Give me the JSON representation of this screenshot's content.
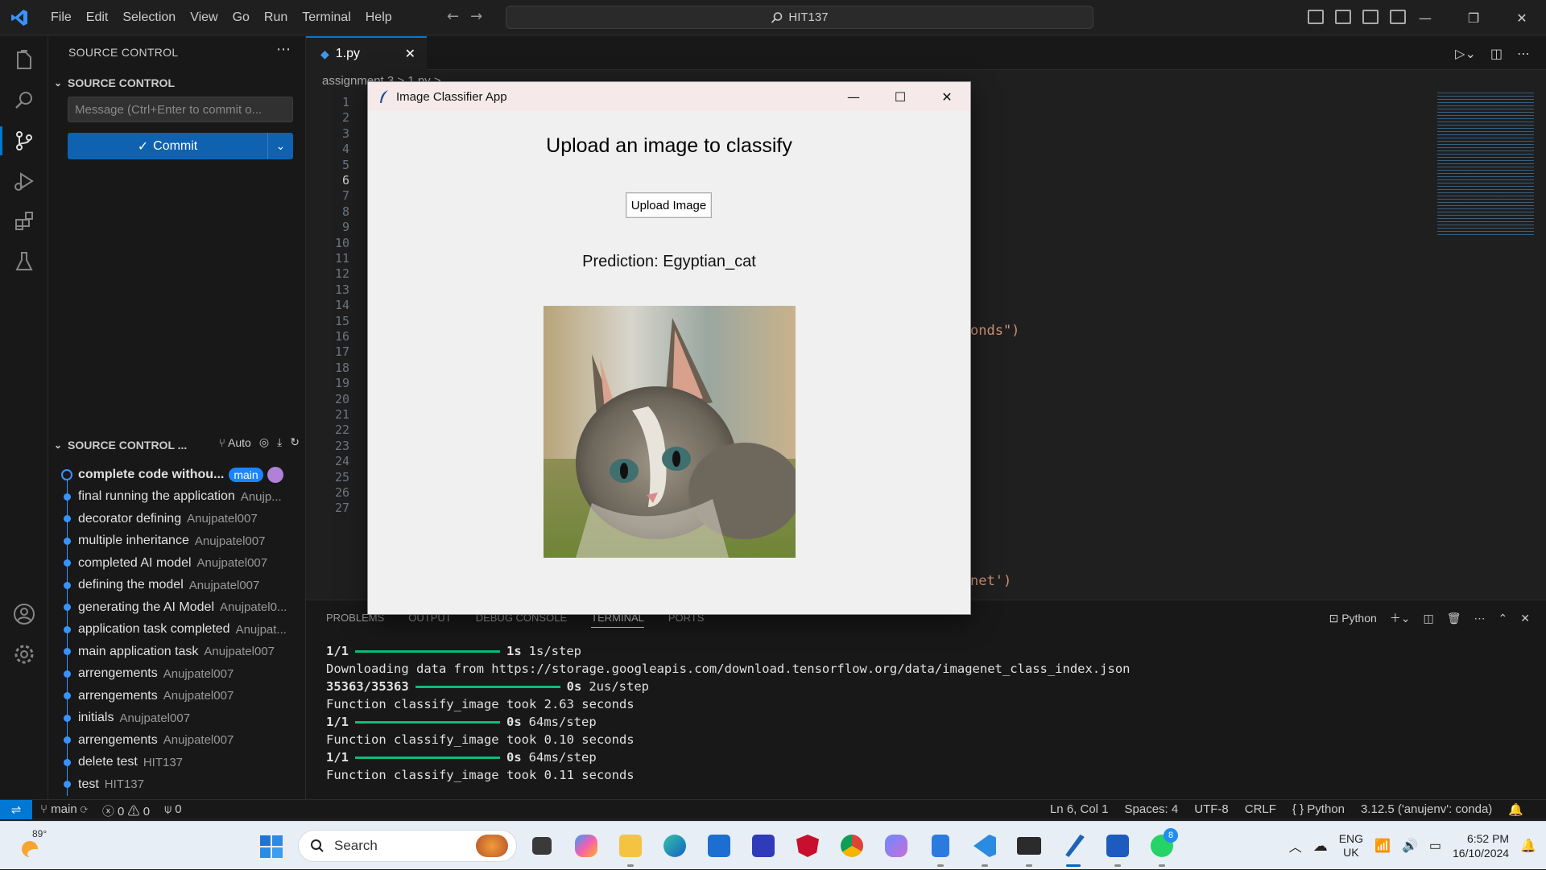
{
  "menu": [
    "File",
    "Edit",
    "Selection",
    "View",
    "Go",
    "Run",
    "Terminal",
    "Help"
  ],
  "search": {
    "text": "HIT137"
  },
  "sidebar": {
    "title": "SOURCE CONTROL",
    "section_title": "SOURCE CONTROL",
    "message_placeholder": "Message (Ctrl+Enter to commit o...",
    "commit_label": "Commit",
    "graph_title": "SOURCE CONTROL ...",
    "graph_auto": "Auto",
    "branch_badge": "main",
    "commits": [
      {
        "msg": "complete code withou...",
        "author": ""
      },
      {
        "msg": "final running the application",
        "author": "Anujp..."
      },
      {
        "msg": "decorator defining",
        "author": "Anujpatel007"
      },
      {
        "msg": "multiple inheritance",
        "author": "Anujpatel007"
      },
      {
        "msg": "completed AI model",
        "author": "Anujpatel007"
      },
      {
        "msg": "defining the model",
        "author": "Anujpatel007"
      },
      {
        "msg": "generating the AI Model",
        "author": "Anujpatel0..."
      },
      {
        "msg": "application task completed",
        "author": "Anujpat..."
      },
      {
        "msg": "main application task",
        "author": "Anujpatel007"
      },
      {
        "msg": "arrengements",
        "author": "Anujpatel007"
      },
      {
        "msg": "arrengements",
        "author": "Anujpatel007"
      },
      {
        "msg": "initials",
        "author": "Anujpatel007"
      },
      {
        "msg": "arrengements",
        "author": "Anujpatel007"
      },
      {
        "msg": "delete test",
        "author": "HIT137"
      },
      {
        "msg": "test",
        "author": "HIT137"
      }
    ]
  },
  "editor": {
    "tab": "1.py",
    "breadcrumb": "assignment 3 > 1.py >",
    "line_numbers": [
      "1",
      "2",
      "3",
      "4",
      "5",
      "6",
      "7",
      "8",
      "9",
      "10",
      "11",
      "12",
      "13",
      "14",
      "15",
      "16",
      "17",
      "18",
      "19",
      "20",
      "21",
      "22",
      "23",
      "24",
      "25",
      "26",
      "27"
    ],
    "frag_13": "onds\")",
    "frag_26": "net')"
  },
  "panel": {
    "tabs": [
      "PROBLEMS",
      "OUTPUT",
      "DEBUG CONSOLE",
      "TERMINAL",
      "PORTS"
    ],
    "active_tab": "TERMINAL",
    "shell": "Python",
    "lines": [
      {
        "prefix": "1/1",
        "bar": true,
        "time": "1s",
        "rest": "1s/step"
      },
      {
        "text": "Downloading data from https://storage.googleapis.com/download.tensorflow.org/data/imagenet_class_index.json"
      },
      {
        "prefix": "35363/35363",
        "bar": true,
        "time": "0s",
        "rest": "2us/step"
      },
      {
        "text": "Function classify_image took 2.63 seconds"
      },
      {
        "prefix": "1/1",
        "bar": true,
        "time": "0s",
        "rest": "64ms/step"
      },
      {
        "text": "Function classify_image took 0.10 seconds"
      },
      {
        "prefix": "1/1",
        "bar": true,
        "time": "0s",
        "rest": "64ms/step"
      },
      {
        "text": "Function classify_image took 0.11 seconds"
      }
    ]
  },
  "statusbar": {
    "branch": "main",
    "errors": "0",
    "warnings": "0",
    "ports": "0",
    "position": "Ln 6, Col 1",
    "spaces": "Spaces: 4",
    "encoding": "UTF-8",
    "eol": "CRLF",
    "language": "Python",
    "interpreter": "3.12.5 ('anujenv': conda)"
  },
  "dialog": {
    "title": "Image Classifier App",
    "heading": "Upload an image to classify",
    "button": "Upload Image",
    "prediction": "Prediction: Egyptian_cat"
  },
  "taskbar": {
    "weather": "89°",
    "search_label": "Search",
    "lang_top": "ENG",
    "lang_bottom": "UK",
    "time": "6:52 PM",
    "date": "16/10/2024",
    "whatsapp_badge": "8"
  },
  "colors": {
    "accent": "#0078d4",
    "terminal_bar": "#0dbc79",
    "string": "#ce9178"
  }
}
